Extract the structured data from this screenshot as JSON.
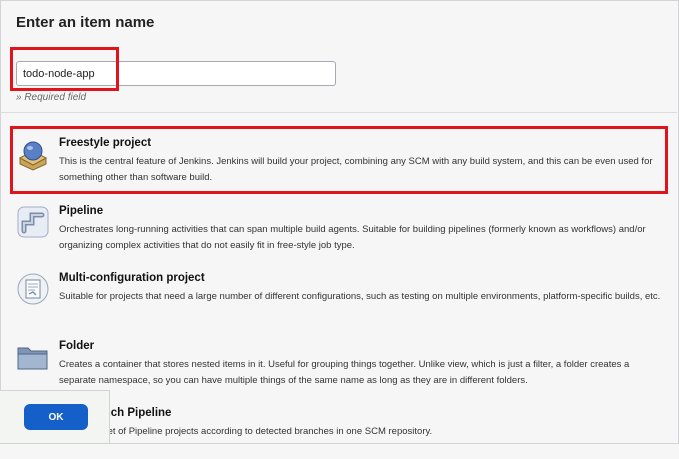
{
  "header": {
    "title": "Enter an item name"
  },
  "name_field": {
    "value": "todo-node-app",
    "required_note": "» Required field"
  },
  "items": [
    {
      "label": "Freestyle project",
      "icon": "freestyle-project-icon",
      "description": "This is the central feature of Jenkins. Jenkins will build your project, combining any SCM with any build system, and this can be even used for something other than software build."
    },
    {
      "label": "Pipeline",
      "icon": "pipeline-icon",
      "description": "Orchestrates long-running activities that can span multiple build agents. Suitable for building pipelines (formerly known as workflows) and/or organizing complex activities that do not easily fit in free-style job type."
    },
    {
      "label": "Multi-configuration project",
      "icon": "multi-configuration-icon",
      "description": "Suitable for projects that need a large number of different configurations, such as testing on multiple environments, platform-specific builds, etc."
    },
    {
      "label": "Folder",
      "icon": "folder-icon",
      "description": "Creates a container that stores nested items in it. Useful for grouping things together. Unlike view, which is just a filter, a folder creates a separate namespace, so you can have multiple things of the same name as long as they are in different folders."
    },
    {
      "label": "Multibranch Pipeline",
      "icon": "multibranch-pipeline-icon",
      "description": "Creates a set of Pipeline projects according to detected branches in one SCM repository."
    }
  ],
  "footer": {
    "ok_label": "OK"
  },
  "colors": {
    "highlight": "#e0141b",
    "ok_button": "#1560c8"
  }
}
